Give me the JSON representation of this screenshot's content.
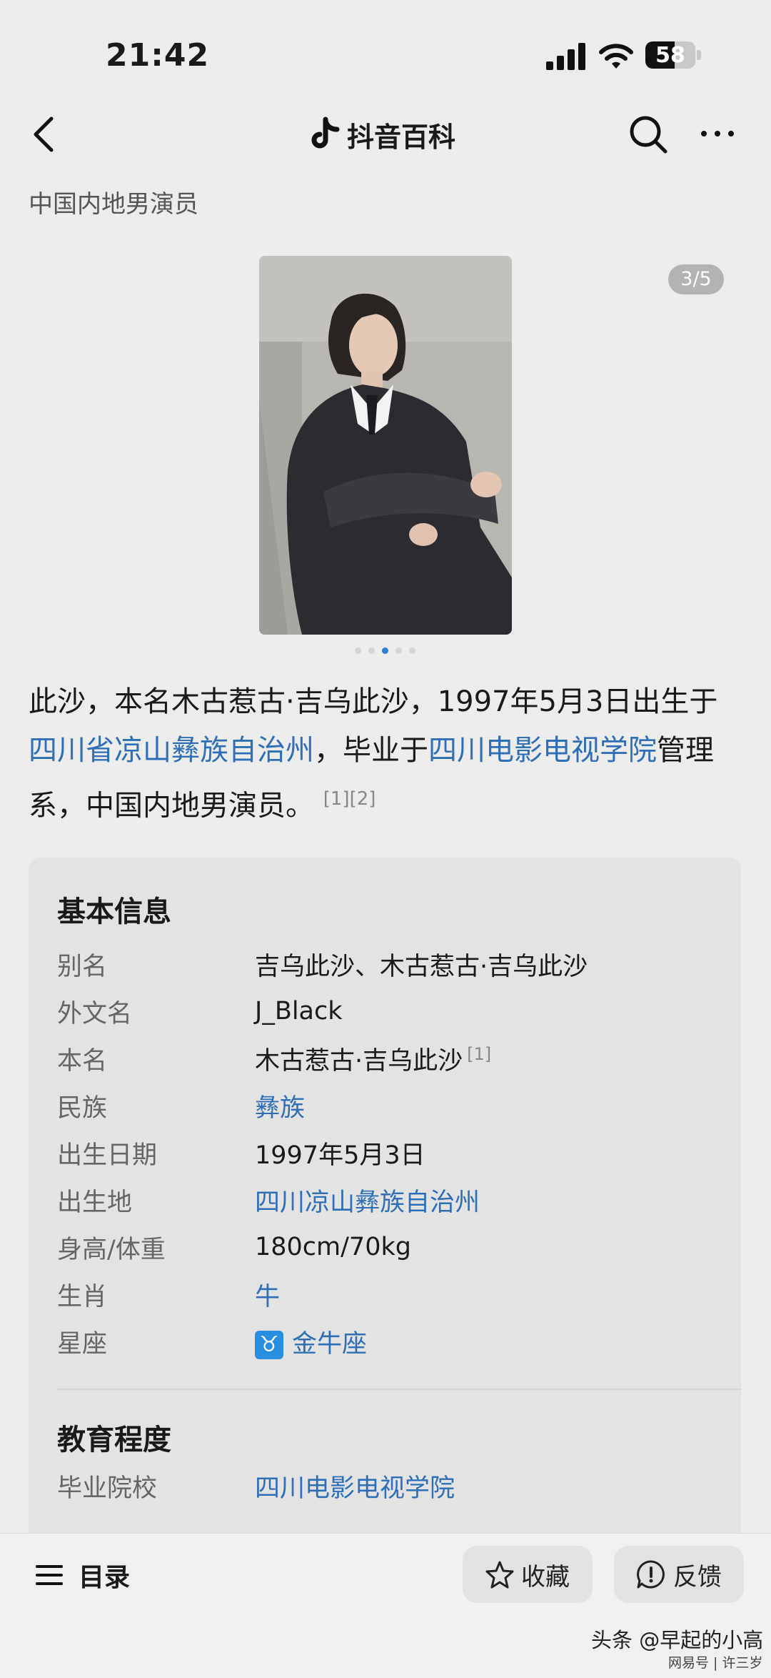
{
  "status_bar": {
    "time": "21:42",
    "battery": "58",
    "battery_level": 0.58
  },
  "nav": {
    "brand": "抖音百科"
  },
  "subtitle": "中国内地男演员",
  "gallery": {
    "counter": "3/5",
    "dot_count": 5,
    "active_dot": 2
  },
  "intro": {
    "part1": "此沙，本名木古惹古·吉乌此沙，1997年5月3日出生于",
    "link1": "四川省凉山彝族自治州",
    "part2": "，毕业于",
    "link2": "四川电影电视学院",
    "part3": "管理系，中国内地男演员。",
    "ref1": "[1]",
    "ref2": "[2]"
  },
  "basic_info": {
    "title": "基本信息",
    "rows": [
      {
        "key": "别名",
        "value": "吉乌此沙、木古惹古·吉乌此沙"
      },
      {
        "key": "外文名",
        "value": "J_Black"
      },
      {
        "key": "本名",
        "value": "木古惹古·吉乌此沙",
        "ref": "[1]"
      },
      {
        "key": "民族",
        "value": "彝族"
      },
      {
        "key": "出生日期",
        "value": "1997年5月3日"
      },
      {
        "key": "出生地",
        "value": "四川凉山彝族自治州"
      },
      {
        "key": "身高/体重",
        "value": "180cm/70kg"
      },
      {
        "key": "生肖",
        "value": "牛"
      },
      {
        "key": "星座",
        "value": "金牛座",
        "symbol": "♉"
      }
    ]
  },
  "education": {
    "title": "教育程度",
    "rows": [
      {
        "key": "毕业院校",
        "value": "四川电影电视学院"
      }
    ]
  },
  "bottom_bar": {
    "toc_label": "目录",
    "favorite_label": "收藏",
    "feedback_label": "反馈"
  },
  "watermark": {
    "text": "头条 @早起的小高",
    "sub": "网易号 | 许三岁"
  },
  "colors": {
    "link": "#2f6fb7",
    "accent_dot": "#2e7fd6",
    "zodiac_badge": "#2a8ee0"
  }
}
